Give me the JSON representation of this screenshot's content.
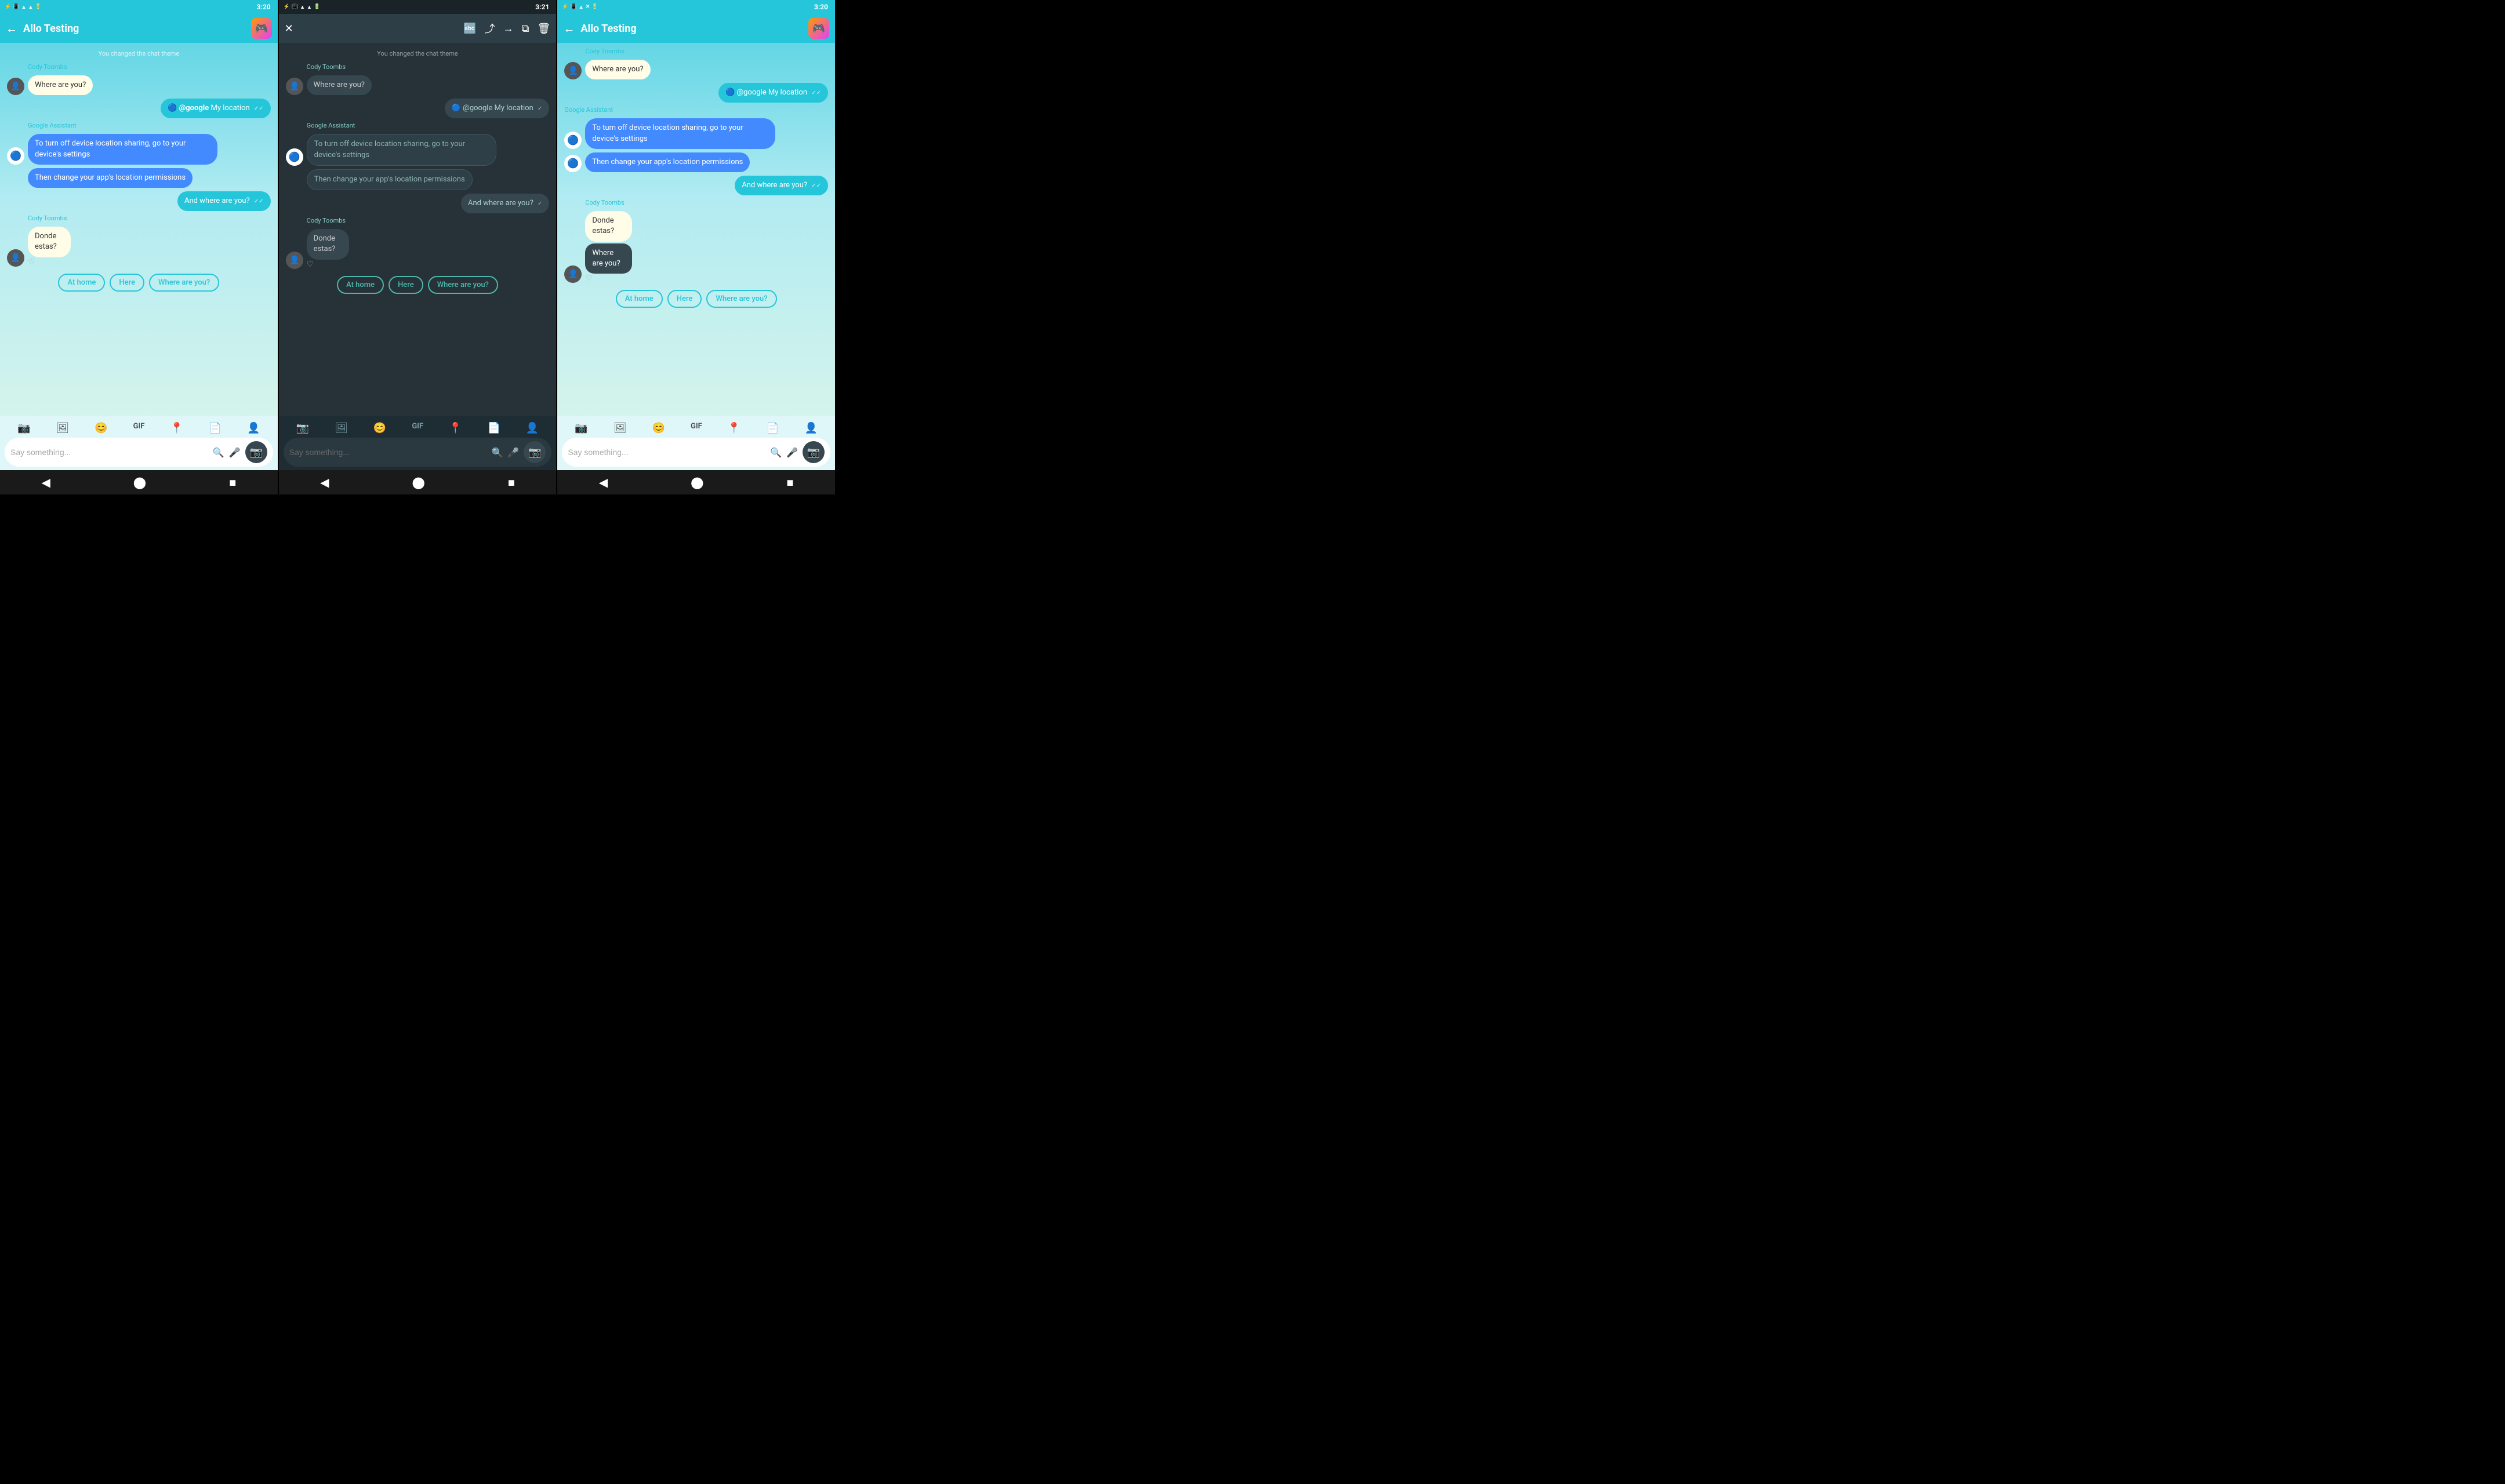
{
  "panels": [
    {
      "id": "panel-1",
      "theme": "light",
      "statusBar": {
        "time": "3:20",
        "icons": "🔵📳📶📶🔋"
      },
      "header": {
        "title": "Allo Testing",
        "hasBack": true,
        "hasAppIcon": true
      },
      "systemMsg": "You changed the chat theme",
      "messages": [
        {
          "type": "received",
          "sender": "Cody Toombs",
          "text": "Where are you?",
          "hasAvatar": true
        },
        {
          "type": "sent",
          "text": "@google My location",
          "hasGoogleDot": true
        },
        {
          "type": "assistant-label",
          "sender": "Google Assistant"
        },
        {
          "type": "assistant",
          "text": "To turn off device location sharing, go to your device's settings"
        },
        {
          "type": "assistant",
          "text": "Then change your app's location permissions"
        },
        {
          "type": "sent",
          "text": "And where are you?"
        },
        {
          "type": "received",
          "sender": "Cody Toombs",
          "text": "Donde estas?",
          "hasAvatar": true,
          "hasHeart": true
        }
      ],
      "quickReplies": [
        "At home",
        "Here",
        "Where are you?"
      ],
      "inputBar": {
        "placeholder": "Say something...",
        "icons": [
          "📷",
          "🖼",
          "😊",
          "GIF",
          "📍",
          "📄",
          "👤"
        ]
      }
    },
    {
      "id": "panel-2",
      "theme": "dark",
      "statusBar": {
        "time": "3:21",
        "icons": "🔵📳📶📶🔋"
      },
      "header": {
        "hasClose": true,
        "headerActions": [
          "translate",
          "share",
          "forward",
          "copy",
          "delete"
        ]
      },
      "systemMsg": "You changed the chat theme",
      "messages": [
        {
          "type": "received",
          "sender": "Cody Toombs",
          "text": "Where are you?",
          "hasAvatar": true
        },
        {
          "type": "sent",
          "text": "@google My location",
          "hasGoogleDot": true
        },
        {
          "type": "assistant-label",
          "sender": "Google Assistant"
        },
        {
          "type": "assistant",
          "text": "To turn off device location sharing, go to your device's settings"
        },
        {
          "type": "assistant",
          "text": "Then change your app's location permissions"
        },
        {
          "type": "sent",
          "text": "And where are you?"
        },
        {
          "type": "received",
          "sender": "Cody Toombs",
          "text": "Donde estas?",
          "hasAvatar": true,
          "hasHeart": true
        }
      ],
      "quickReplies": [
        "At home",
        "Here",
        "Where are you?"
      ],
      "inputBar": {
        "placeholder": "Say something...",
        "icons": [
          "📷",
          "🖼",
          "😊",
          "GIF",
          "📍",
          "📄",
          "👤"
        ]
      }
    },
    {
      "id": "panel-3",
      "theme": "light",
      "statusBar": {
        "time": "3:20",
        "icons": "🔵📳📶❌🔋"
      },
      "header": {
        "title": "Allo Testing",
        "hasBack": true,
        "hasAppIcon": true
      },
      "messages": [
        {
          "type": "received-compact",
          "sender": "Cody Toombs",
          "text": "Where are you?",
          "hasAvatar": true
        },
        {
          "type": "sent",
          "text": "@google My location",
          "hasGoogleDot": true
        },
        {
          "type": "assistant-label",
          "sender": "Google Assistant"
        },
        {
          "type": "assistant",
          "text": "To turn off device location sharing, go to your device's settings"
        },
        {
          "type": "assistant",
          "text": "Then change your app's location permissions",
          "hasGAIcon": true
        },
        {
          "type": "sent",
          "text": "And where are you?"
        },
        {
          "type": "received",
          "sender": "Cody Toombs",
          "text": "Donde estas?",
          "hasAvatar": true,
          "hasHeart": true
        },
        {
          "type": "translated",
          "text": "Where are you?"
        }
      ],
      "quickReplies": [
        "At home",
        "Here",
        "Where are you?"
      ],
      "inputBar": {
        "placeholder": "Say something...",
        "icons": [
          "📷",
          "🖼",
          "😊",
          "GIF",
          "📍",
          "📄",
          "👤"
        ]
      }
    }
  ],
  "bottomNav": {
    "back": "◀",
    "home": "⬤",
    "recent": "■"
  },
  "labels": {
    "backArrow": "←",
    "closeX": "✕",
    "sendCamera": "📷",
    "checkDouble": "✓✓",
    "heartEmpty": "♡",
    "googleAt": "@google"
  }
}
